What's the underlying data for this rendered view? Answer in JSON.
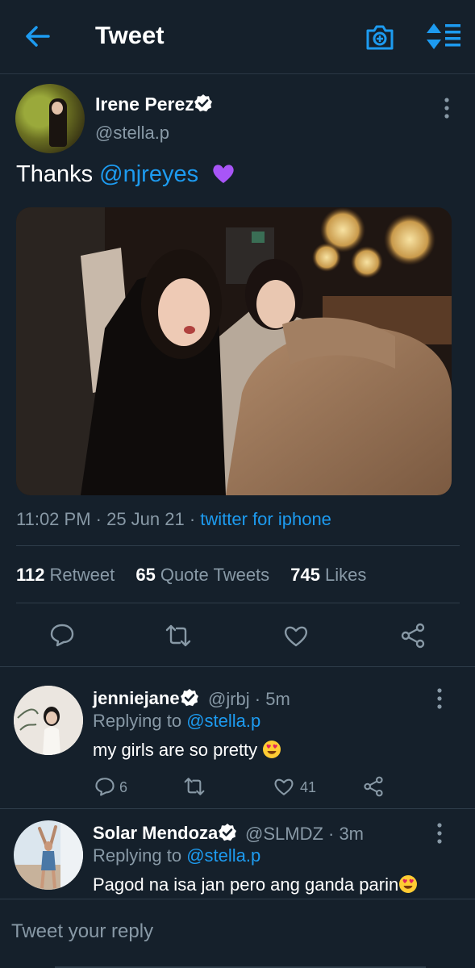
{
  "header": {
    "title": "Tweet",
    "back_icon": "arrow-left-icon",
    "camera_icon": "camera-plus-icon",
    "sort_icon": "sort-icon",
    "accent": "#1d9bf0"
  },
  "tweet": {
    "author_name": "Irene Perez",
    "author_handle": "@stella.p",
    "text_prefix": "Thanks ",
    "mention": "@njreyes",
    "emoji": "purple-heart-emoji",
    "time": "11:02 PM · 25 Jun 21 · ",
    "source": "twitter for iphone",
    "stats": {
      "retweets": "112",
      "retweets_label": "Retweet",
      "quotes": "65",
      "quotes_label": "Quote Tweets",
      "likes": "745",
      "likes_label": "Likes"
    }
  },
  "replies": [
    {
      "name": "jenniejane",
      "handle": "@jrbj · 5m",
      "replying_label": "Replying to ",
      "replying_to": "@stella.p",
      "text": "my girls are so pretty",
      "emoji": "heart-eyes-emoji",
      "reply_count": "6",
      "retweet_count": "",
      "like_count": "41"
    },
    {
      "name": "Solar Mendoza",
      "handle": "@SLMDZ · 3m",
      "replying_label": "Replying to ",
      "replying_to": "@stella.p",
      "text": "Pagod na isa jan pero ang ganda parin",
      "emoji": "heart-eyes-emoji"
    }
  ],
  "composer": {
    "placeholder": "Tweet your reply"
  }
}
